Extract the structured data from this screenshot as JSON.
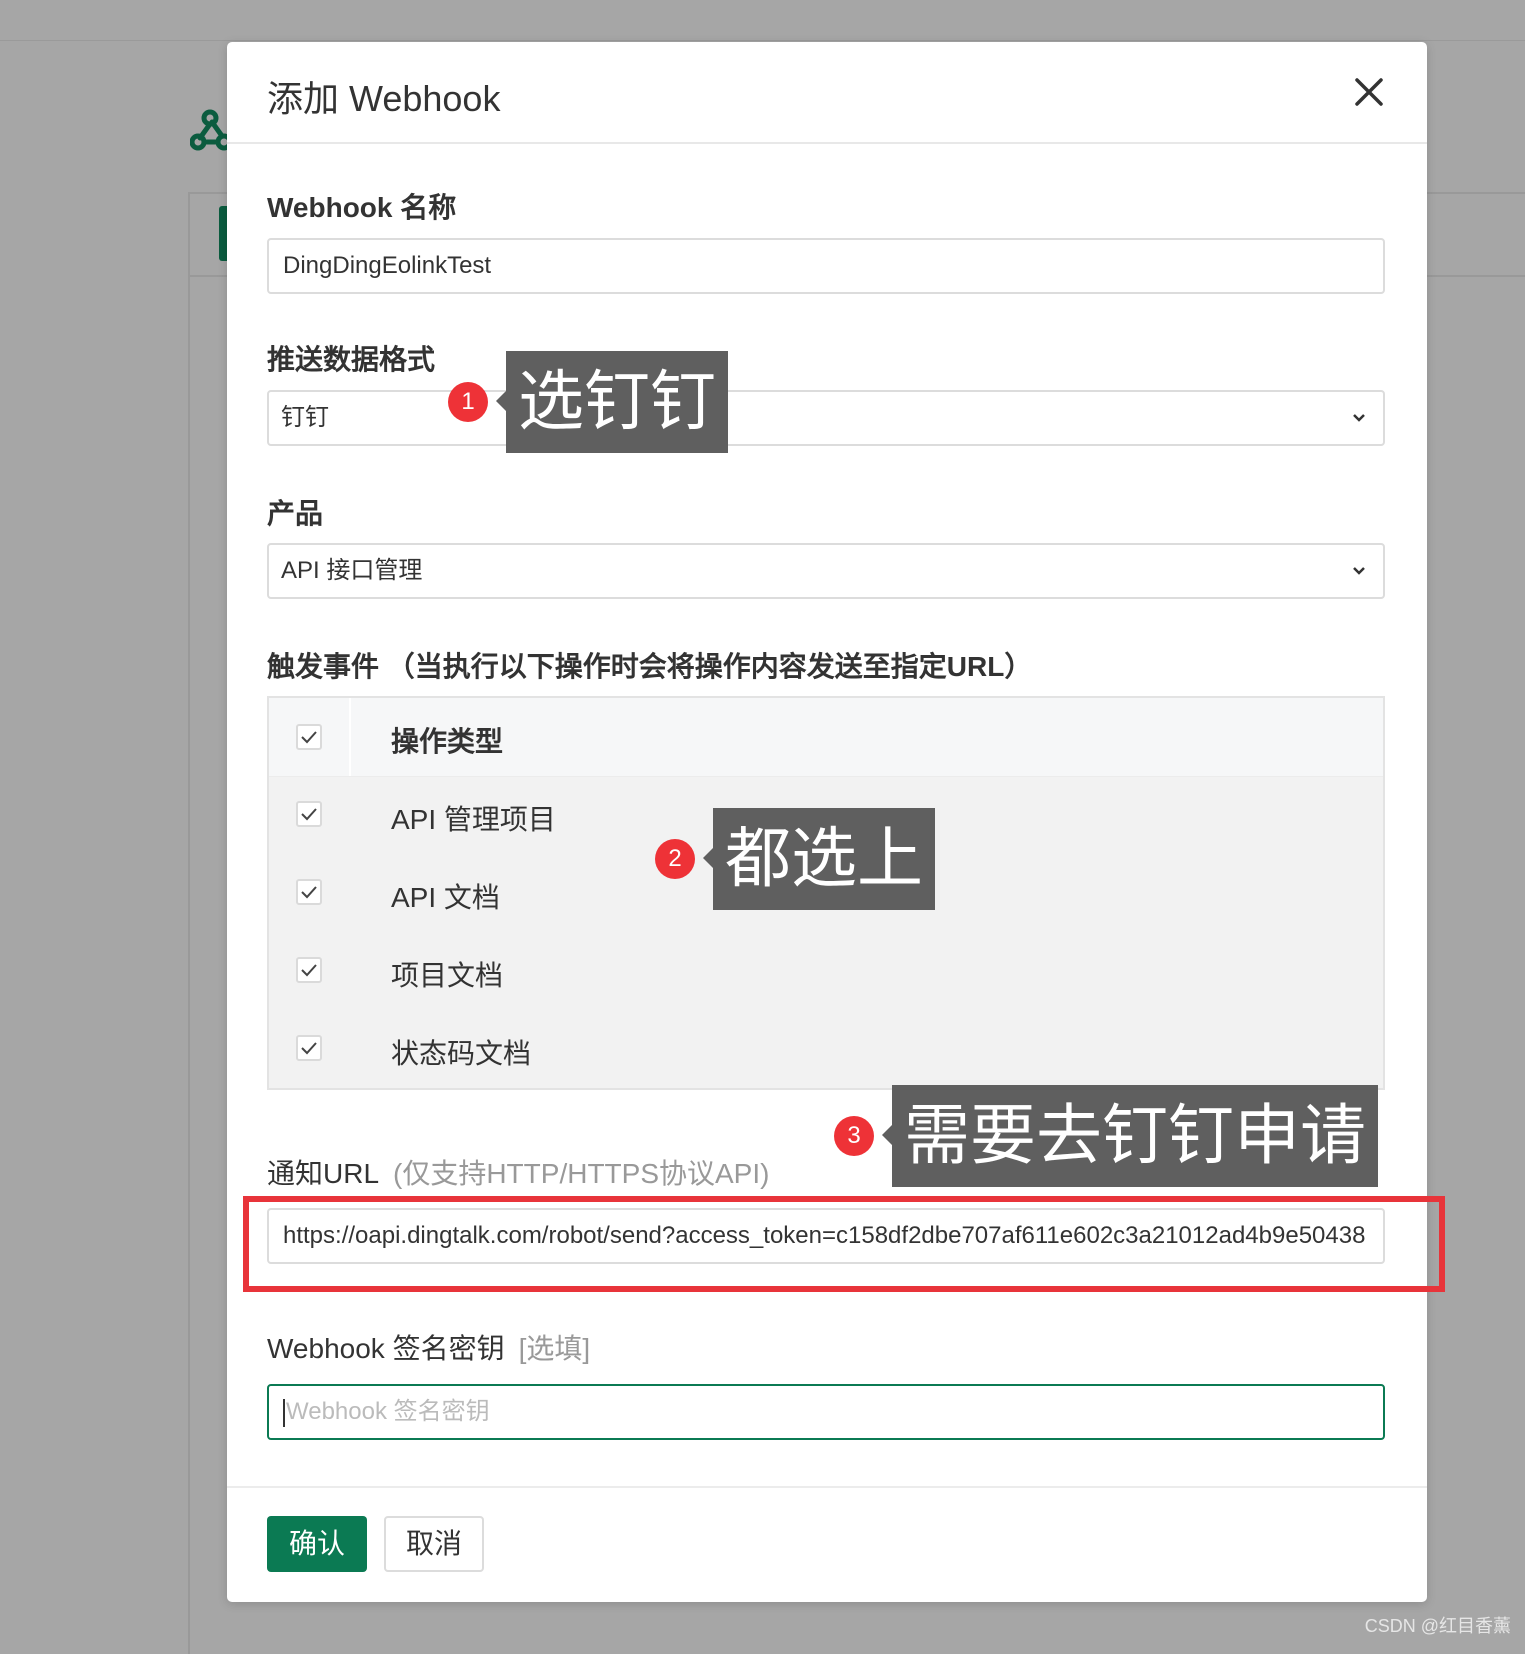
{
  "modal": {
    "title": "添加 Webhook"
  },
  "form": {
    "name_label": "Webhook 名称",
    "name_value": "DingDingEolinkTest",
    "format_label": "推送数据格式",
    "format_value": "钉钉",
    "product_label": "产品",
    "product_value": "API 接口管理",
    "events_label": "触发事件 （当执行以下操作时会将操作内容发送至指定URL）",
    "events_header": "操作类型",
    "events": [
      {
        "label": "API 管理项目",
        "checked": true
      },
      {
        "label": "API 文档",
        "checked": true
      },
      {
        "label": "项目文档",
        "checked": true
      },
      {
        "label": "状态码文档",
        "checked": true
      }
    ],
    "url_label": "通知URL",
    "url_hint": "(仅支持HTTP/HTTPS协议API)",
    "url_value": "https://oapi.dingtalk.com/robot/send?access_token=c158df2dbe707af611e602c3a21012ad4b9e50438",
    "secret_label": "Webhook 签名密钥",
    "secret_hint": "[选填]",
    "secret_placeholder": "Webhook 签名密钥"
  },
  "buttons": {
    "confirm": "确认",
    "cancel": "取消"
  },
  "annotations": [
    {
      "number": "1",
      "text": "选钉钉"
    },
    {
      "number": "2",
      "text": "都选上"
    },
    {
      "number": "3",
      "text": "需要去钉钉申请"
    }
  ],
  "watermark": "CSDN @红目香薰",
  "colors": {
    "primary": "#0b7a53",
    "annotation_badge": "#ee3237",
    "annotation_callout": "#5f5f5f",
    "highlight_box": "#e8343a"
  }
}
